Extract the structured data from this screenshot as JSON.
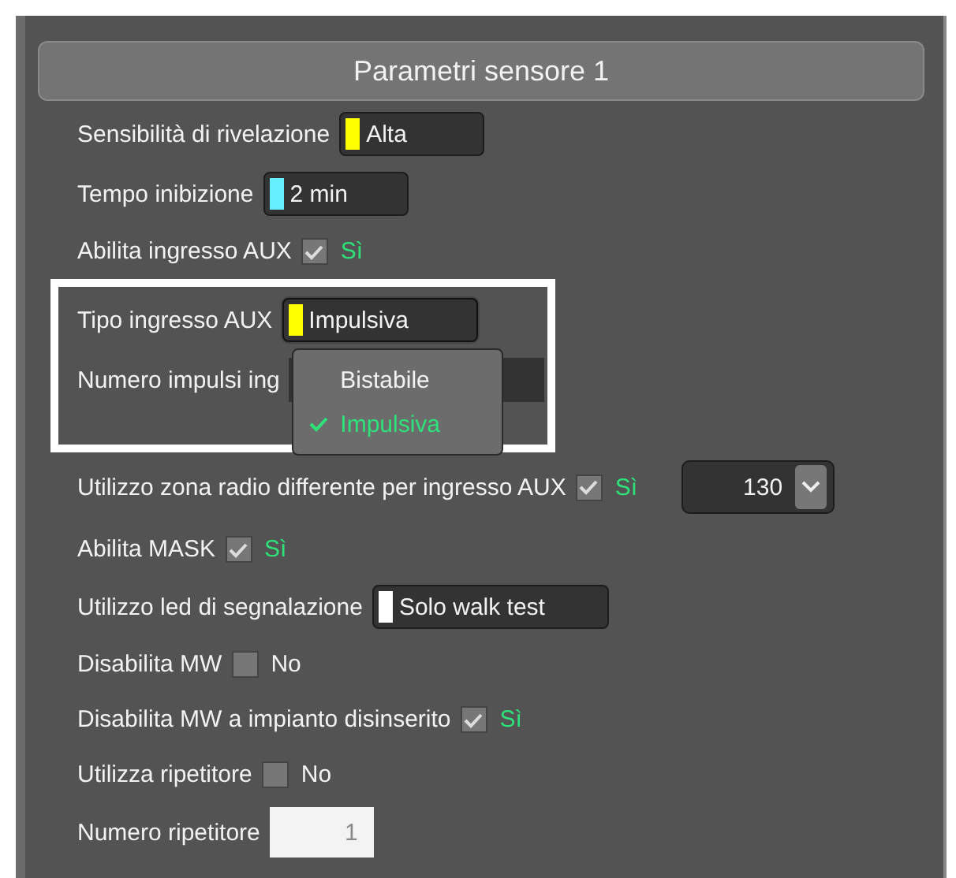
{
  "panel": {
    "title": "Parametri sensore 1"
  },
  "rows": [
    {
      "kind": "select",
      "label": "Sensibilità di rivelazione",
      "value": "Alta",
      "color": "#ffff00"
    },
    {
      "kind": "select",
      "label": "Tempo inibizione",
      "value": "2 min",
      "color": "#66f0ff"
    },
    {
      "kind": "check",
      "label": "Abilita ingresso AUX",
      "checked": true,
      "value": "Sì"
    },
    {
      "kind": "select",
      "label": "Tipo ingresso AUX",
      "value": "Impulsiva",
      "color": "#ffff00",
      "open": true
    },
    {
      "kind": "covered",
      "label": "Numero impulsi ing"
    },
    {
      "kind": "check_number",
      "label": "Utilizzo zona radio differente per ingresso AUX",
      "checked": true,
      "value": "Sì",
      "number": "130"
    },
    {
      "kind": "check",
      "label": "Abilita MASK",
      "checked": true,
      "value": "Sì"
    },
    {
      "kind": "select",
      "label": "Utilizzo led di segnalazione",
      "value": "Solo walk test",
      "color": "#ffffff"
    },
    {
      "kind": "check",
      "label": "Disabilita MW",
      "checked": false,
      "value": "No"
    },
    {
      "kind": "check",
      "label": "Disabilita MW a impianto disinserito",
      "checked": true,
      "value": "Sì"
    },
    {
      "kind": "check",
      "label": "Utilizza ripetitore",
      "checked": false,
      "value": "No"
    },
    {
      "kind": "number",
      "label": "Numero ripetitore",
      "value": "1"
    }
  ],
  "dropdown_options": [
    {
      "label": "Bistabile",
      "selected": false
    },
    {
      "label": "Impulsiva",
      "selected": true
    }
  ]
}
